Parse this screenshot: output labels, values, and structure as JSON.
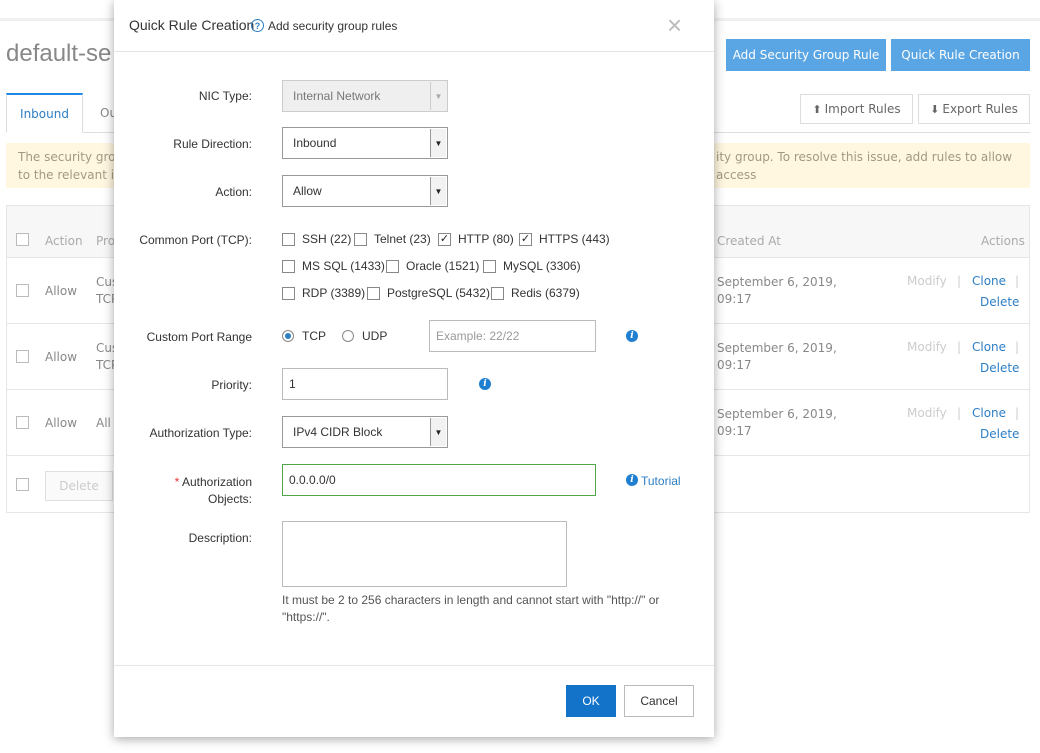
{
  "background": {
    "page_title": "default-se",
    "buttons": {
      "add_rule": "Add Security Group Rule",
      "quick_rule": "Quick Rule Creation",
      "import_rules": "Import Rules",
      "export_rules": "Export Rules"
    },
    "tabs": {
      "inbound": "Inbound",
      "outbound_partial": "Ou"
    },
    "notice": {
      "left_line1": "The security group",
      "left_line2": "to the relevant inst",
      "right_line1": "ity group. To resolve this issue, add rules to allow access"
    },
    "table": {
      "headers": {
        "action": "Action",
        "protocol_partial": "Pro",
        "created_at": "Created At",
        "actions": "Actions"
      },
      "rows": [
        {
          "action": "Allow",
          "protocol_line1": "Cus",
          "protocol_line2": "TCP",
          "date_line1": "September 6, 2019,",
          "date_line2": "09:17"
        },
        {
          "action": "Allow",
          "protocol_line1": "Cus",
          "protocol_line2": "TCP",
          "date_line1": "September 6, 2019,",
          "date_line2": "09:17"
        },
        {
          "action": "Allow",
          "protocol_line1": "All I",
          "protocol_line2": "",
          "date_line1": "September 6, 2019,",
          "date_line2": "09:17"
        }
      ],
      "row_actions": {
        "modify": "Modify",
        "clone": "Clone",
        "delete": "Delete",
        "separator": "|"
      },
      "footer_delete": "Delete"
    }
  },
  "dialog": {
    "title": "Quick Rule Creation",
    "help_glyph": "?",
    "subtitle": "Add security group rules",
    "close_glyph": "×",
    "nic_type": {
      "label": "NIC Type:",
      "value": "Internal Network"
    },
    "rule_direction": {
      "label": "Rule Direction:",
      "value": "Inbound"
    },
    "action": {
      "label": "Action:",
      "value": "Allow"
    },
    "common_port": {
      "label": "Common Port (TCP):",
      "options": [
        {
          "label": "SSH (22)",
          "checked": false
        },
        {
          "label": "Telnet (23)",
          "checked": false
        },
        {
          "label": "HTTP (80)",
          "checked": true
        },
        {
          "label": "HTTPS (443)",
          "checked": true
        },
        {
          "label": "MS SQL (1433)",
          "checked": false
        },
        {
          "label": "Oracle (1521)",
          "checked": false
        },
        {
          "label": "MySQL (3306)",
          "checked": false
        },
        {
          "label": "RDP (3389)",
          "checked": false
        },
        {
          "label": "PostgreSQL (5432)",
          "checked": false
        },
        {
          "label": "Redis (6379)",
          "checked": false
        }
      ]
    },
    "custom_port": {
      "label": "Custom Port Range",
      "tcp": "TCP",
      "udp": "UDP",
      "selected": "TCP",
      "placeholder": "Example: 22/22"
    },
    "priority": {
      "label": "Priority:",
      "value": "1"
    },
    "auth_type": {
      "label": "Authorization Type:",
      "value": "IPv4 CIDR Block"
    },
    "auth_objects": {
      "required_mark": "*",
      "label_line1": "Authorization",
      "label_line2": "Objects:",
      "value": "0.0.0.0/0",
      "tutorial": "Tutorial"
    },
    "description": {
      "label": "Description:",
      "hint": "It must be 2 to 256 characters in length and cannot start with \"http://\" or \"https://\"."
    },
    "info_glyph": "i",
    "buttons": {
      "ok": "OK",
      "cancel": "Cancel"
    }
  },
  "colors": {
    "primary": "#1273c9",
    "link": "#2d7ec4",
    "accent_light": "#5aa5e3",
    "auth_border": "#52a64a"
  }
}
